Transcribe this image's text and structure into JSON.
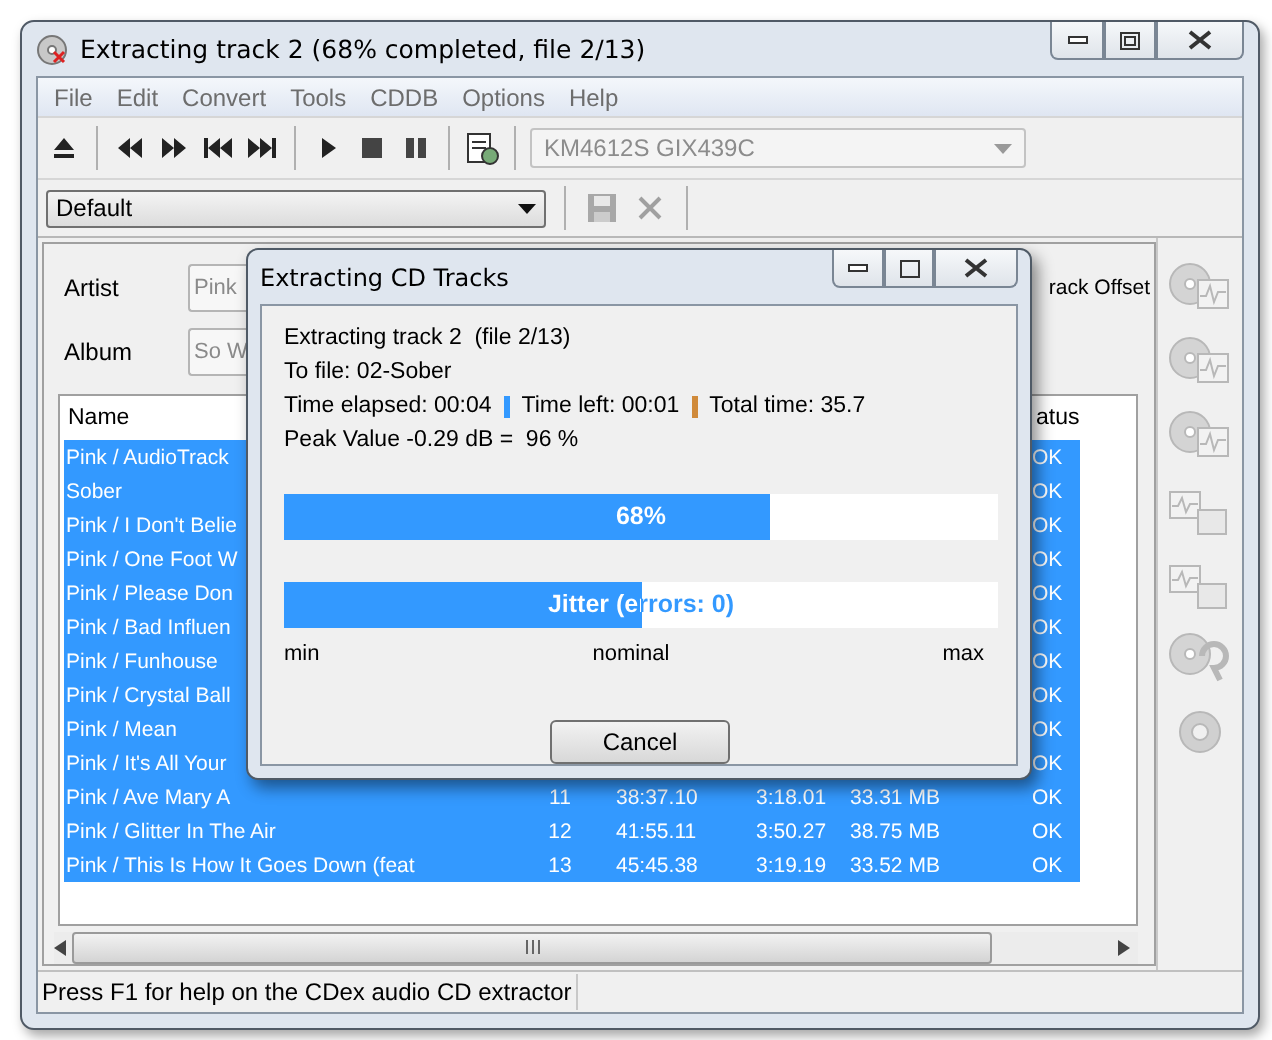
{
  "window": {
    "title": "Extracting track 2 (68% completed, file 2/13)"
  },
  "menu": [
    "File",
    "Edit",
    "Convert",
    "Tools",
    "CDDB",
    "Options",
    "Help"
  ],
  "toolbar": {
    "drive": "KM4612S GIX439C",
    "drive_disabled": true
  },
  "profile": {
    "value": "Default"
  },
  "album_info": {
    "artist_label": "Artist",
    "artist_value": "Pink",
    "album_label": "Album",
    "album_value": "So W",
    "column_3": "rack Offset"
  },
  "track_list": {
    "columns": [
      "Name",
      "atus"
    ],
    "rows": [
      {
        "name": "Pink / AudioTrack",
        "status": "OK",
        "selected": true
      },
      {
        "name": "Sober",
        "status": "OK",
        "selected": true
      },
      {
        "name": "Pink / I Don't Belie",
        "status": "OK",
        "selected": true
      },
      {
        "name": "Pink / One Foot W",
        "status": "OK",
        "selected": true
      },
      {
        "name": "Pink / Please Don",
        "status": "OK",
        "selected": true
      },
      {
        "name": "Pink / Bad Influen",
        "status": "OK",
        "selected": true
      },
      {
        "name": "Pink / Funhouse",
        "status": "OK",
        "selected": true
      },
      {
        "name": "Pink / Crystal Ball",
        "status": "OK",
        "selected": true
      },
      {
        "name": "Pink / Mean",
        "status": "OK",
        "selected": true
      },
      {
        "name": "Pink / It's All Your",
        "status": "OK",
        "selected": true
      },
      {
        "name": "Pink / Ave Mary A",
        "cells": [
          "11",
          "38:37.10",
          "3:18.01",
          "33.31 MB"
        ],
        "status": "OK",
        "selected": true
      },
      {
        "name": "Pink / Glitter In The Air",
        "cells": [
          "12",
          "41:55.11",
          "3:50.27",
          "38.75 MB"
        ],
        "status": "OK",
        "selected": true
      },
      {
        "name": "Pink / This Is How It Goes Down (feat",
        "cells": [
          "13",
          "45:45.38",
          "3:19.19",
          "33.52 MB"
        ],
        "status": "OK",
        "selected": true
      }
    ]
  },
  "dialog": {
    "title": "Extracting CD Tracks",
    "lines": [
      "Extracting track 2  (file 2/13)",
      "To file: 02-Sober"
    ],
    "timings": [
      {
        "text": "Time elapsed: 00:04"
      },
      {
        "text": "Time left: 00:01",
        "color": "#3399ff"
      },
      {
        "text": "Total time: 35.7",
        "color": "#d08a3a"
      }
    ],
    "peak": "Peak Value -0.29 dB =  96 %",
    "progress": {
      "label": "68%",
      "level": 0.68
    },
    "jitter": {
      "label": "Jitter (errors: 0)",
      "level": 0.5
    },
    "scale": [
      "min",
      "nominal",
      "max"
    ],
    "button": "Cancel"
  },
  "status_bar": "Press F1 for help on the CDex audio CD extractor"
}
